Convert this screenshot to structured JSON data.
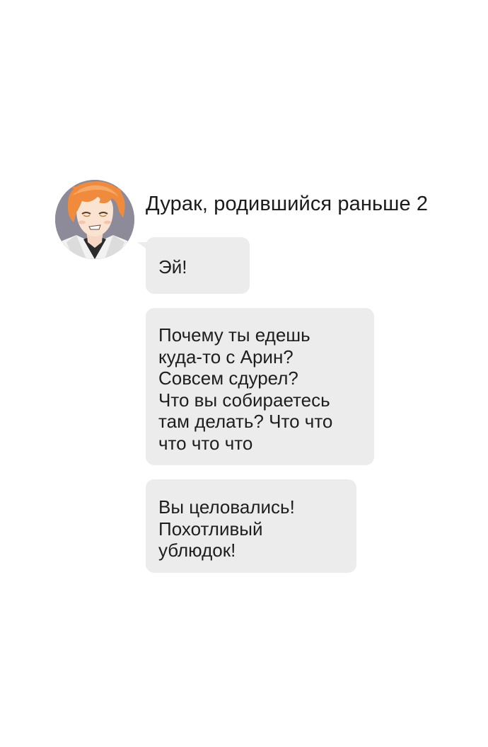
{
  "conversation": {
    "sender_name": "Дурак, родившийся раньше 2",
    "messages": [
      {
        "lines": [
          "Эй!"
        ]
      },
      {
        "lines": [
          "Почему ты едешь",
          "куда-то с Арин?",
          "Совсем сдурел?",
          "Что вы собираетесь",
          "там делать? Что что",
          "что что что"
        ]
      },
      {
        "lines": [
          "Вы целовались!",
          "Похотливый",
          "ублюдок!"
        ]
      }
    ]
  },
  "colors": {
    "bubble_background": "#ececec",
    "page_background": "#ffffff",
    "text": "#1e1e1e",
    "avatar_hair": "#f08a3c"
  },
  "icons": {
    "avatar": "avatar-orange-haired-man"
  }
}
